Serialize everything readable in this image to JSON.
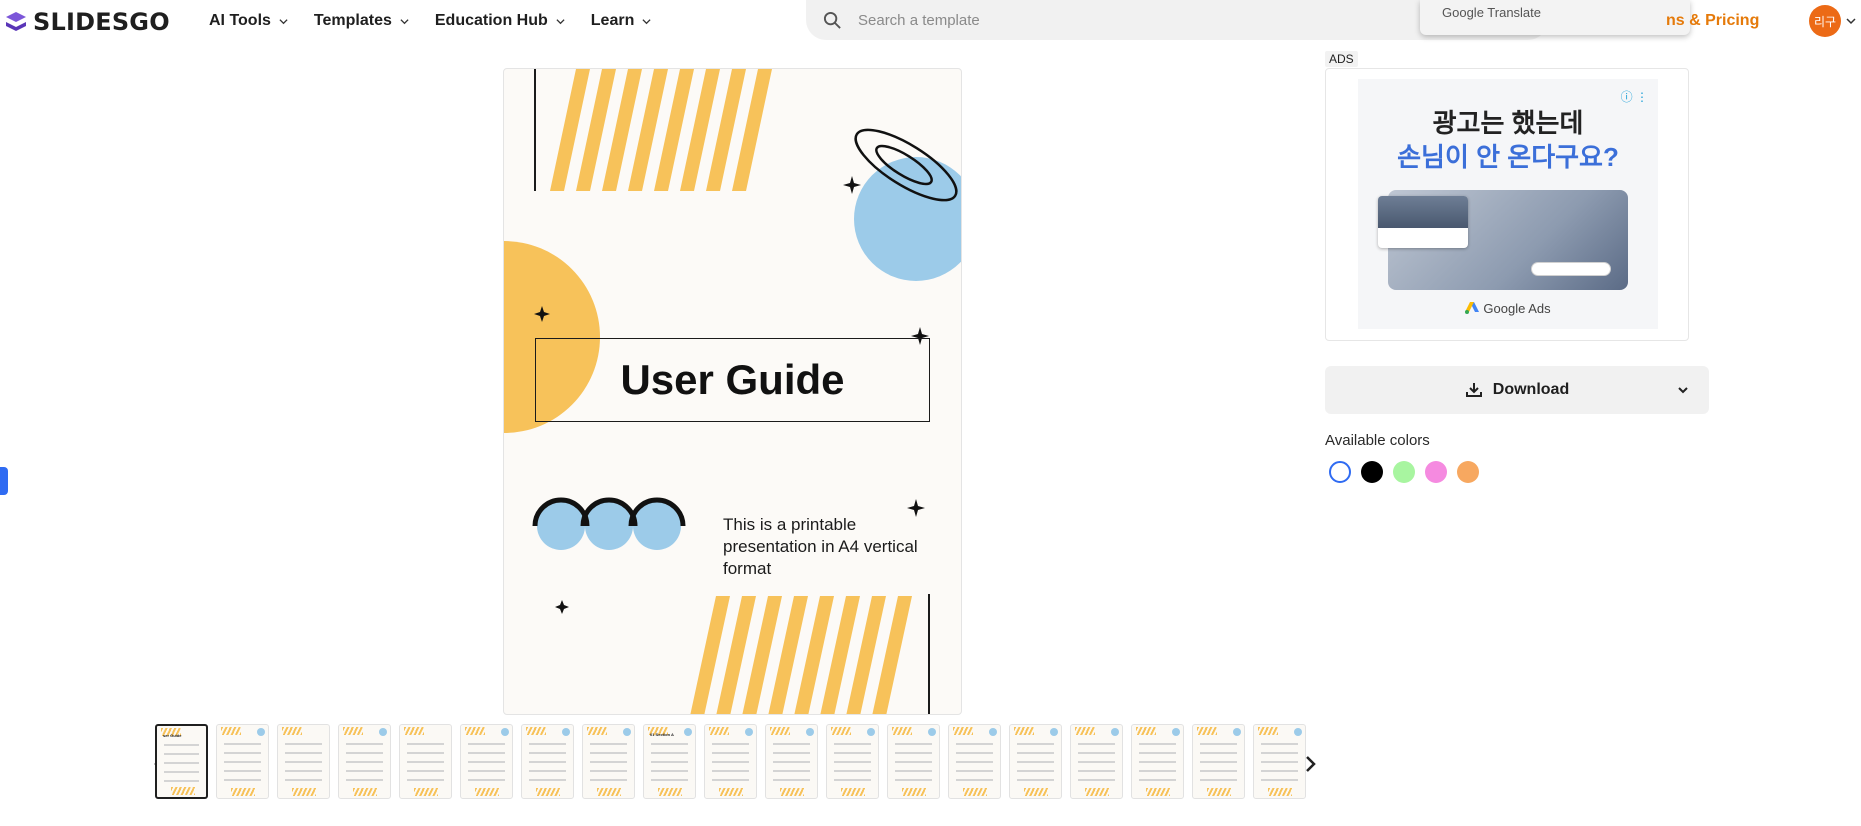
{
  "header": {
    "logo_text": "SLIDESGO",
    "nav": [
      {
        "label": "AI Tools"
      },
      {
        "label": "Templates"
      },
      {
        "label": "Education Hub"
      },
      {
        "label": "Learn"
      }
    ],
    "search_placeholder": "Search a template",
    "translate_label": "Google Translate",
    "pricing_label": "ns & Pricing",
    "avatar_initials": "리구"
  },
  "preview": {
    "title": "User Guide",
    "subtitle": "This is a printable presentation in A4 vertical format"
  },
  "thumbnails": {
    "active_index": 0,
    "items": [
      "ser Guide",
      "",
      "",
      "",
      "",
      "",
      "",
      "",
      "01 Section A",
      "",
      "",
      "",
      "",
      "",
      "",
      "",
      "",
      "",
      ""
    ]
  },
  "ads": {
    "label": "ADS",
    "headline_1": "광고는 했는데",
    "headline_2": "손님이 안 온다구요?",
    "brand": "Google Ads"
  },
  "download": {
    "label": "Download"
  },
  "colors": {
    "label": "Available colors",
    "options": [
      "#ffffff",
      "#000000",
      "#a8f5a0",
      "#f58ae0",
      "#f7a860"
    ]
  },
  "theme": {
    "accent": "#e57a0a",
    "orange": "#f7c25a",
    "blue": "#9ccbe9"
  }
}
